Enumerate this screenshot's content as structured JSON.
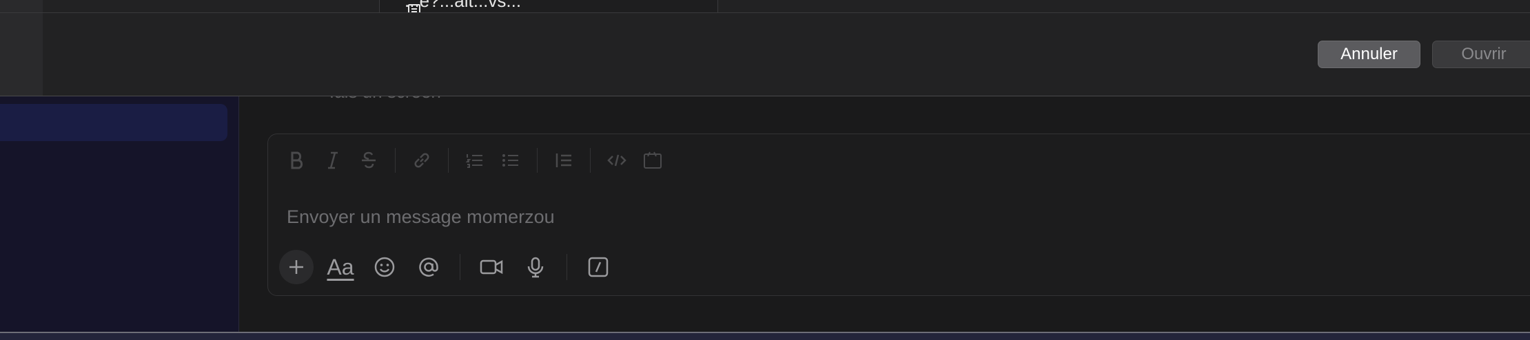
{
  "dialog": {
    "file_name": "...e?...alt...vs...",
    "cancel_label": "Annuler",
    "open_label": "Ouvrir"
  },
  "conversation": {
    "truncated_message": "fais un screen"
  },
  "composer": {
    "placeholder": "Envoyer un message momerzou",
    "text_style_label": "Aa"
  },
  "colors": {
    "sidebar_bg": "#151429",
    "selected_item": "#1a1d44",
    "cancel_button": "#5b5b5e",
    "open_button": "#3a3a3c"
  }
}
